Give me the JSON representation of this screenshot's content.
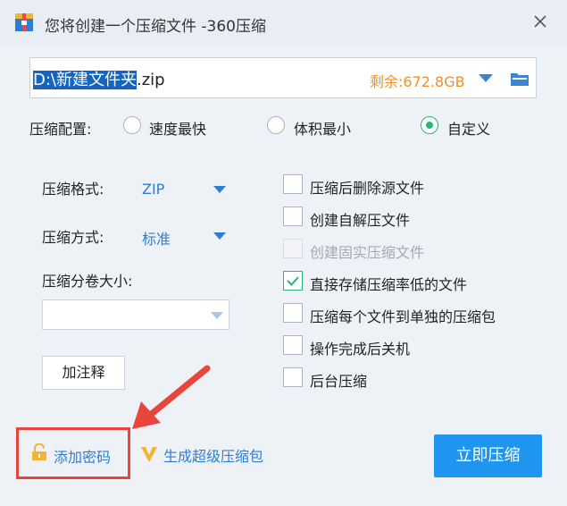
{
  "window": {
    "title": "您将创建一个压缩文件 -360压缩",
    "app_icon": "archive-app-icon",
    "close_icon": "close-icon"
  },
  "path": {
    "selected_part": "D:\\新建文件夹",
    "extension": ".zip",
    "free_space": "剩余:672.8GB",
    "dropdown_icon": "chevron-down-icon",
    "browse_icon": "folder-icon"
  },
  "config": {
    "label": "压缩配置:",
    "options": [
      {
        "label": "速度最快",
        "selected": false
      },
      {
        "label": "体积最小",
        "selected": false
      },
      {
        "label": "自定义",
        "selected": true
      }
    ]
  },
  "settings": {
    "format_label": "压缩格式:",
    "format_value": "ZIP",
    "method_label": "压缩方式:",
    "method_value": "标准",
    "volume_label": "压缩分卷大小:",
    "volume_value": "",
    "comment_button": "加注释"
  },
  "checkboxes": [
    {
      "label": "压缩后删除源文件",
      "checked": false,
      "disabled": false
    },
    {
      "label": "创建自解压文件",
      "checked": false,
      "disabled": false
    },
    {
      "label": "创建固实压缩文件",
      "checked": false,
      "disabled": true
    },
    {
      "label": "直接存储压缩率低的文件",
      "checked": true,
      "disabled": false
    },
    {
      "label": "压缩每个文件到单独的压缩包",
      "checked": false,
      "disabled": false
    },
    {
      "label": "操作完成后关机",
      "checked": false,
      "disabled": false
    },
    {
      "label": "后台压缩",
      "checked": false,
      "disabled": false
    }
  ],
  "footer": {
    "add_password": "添加密码",
    "add_password_icon": "lock-icon",
    "super_pack": "生成超级压缩包",
    "super_pack_icon": "v-badge-icon",
    "compress_now": "立即压缩"
  },
  "colors": {
    "accent_blue": "#1e96f0",
    "link_blue": "#2f7dd1",
    "free_space_orange": "#f0902a",
    "check_green": "#2bb673",
    "highlight_red": "#e8453c"
  }
}
